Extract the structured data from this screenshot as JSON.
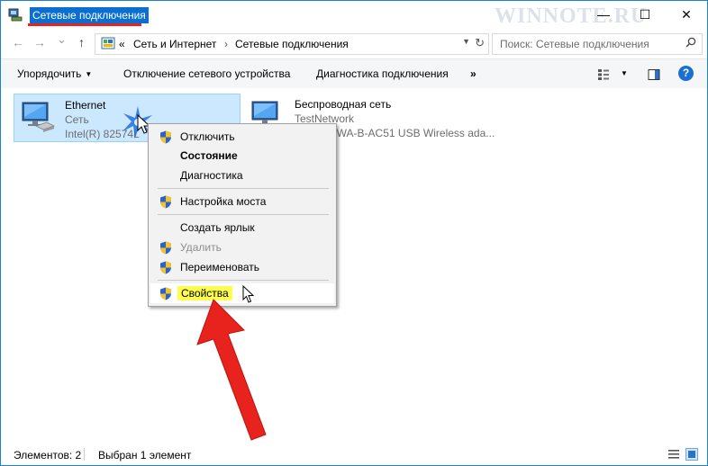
{
  "window": {
    "title": "Сетевые подключения",
    "watermark": "WINNOTE.RU",
    "controls": {
      "minimize": "—",
      "maximize": "☐",
      "close": "✕"
    }
  },
  "address": {
    "back": "←",
    "forward": "→",
    "dropdown": "⌄",
    "up": "↑",
    "chevrons": "«",
    "crumbs": [
      "Сеть и Интернет",
      "Сетевые подключения"
    ],
    "separator": "›",
    "dd_arrow": "▼",
    "refresh": "↻"
  },
  "search": {
    "placeholder": "Поиск: Сетевые подключения"
  },
  "toolbar": {
    "organize": "Упорядочить",
    "organize_arrow": "▼",
    "disable_device": "Отключение сетевого устройства",
    "diagnose": "Диагностика подключения",
    "more": "»",
    "view_arrow": "▼",
    "help": "?"
  },
  "connections": [
    {
      "name": "Ethernet",
      "network": "Сеть",
      "device": "Intel(R) 82574L",
      "selected": true
    },
    {
      "name": "Беспроводная сеть",
      "network": "TestNetwork",
      "device": "D-Link DWA-B-AC51 USB Wireless ada..."
    }
  ],
  "context_menu": {
    "items": [
      {
        "label": "Отключить",
        "shield": true
      },
      {
        "label": "Состояние",
        "bold": true
      },
      {
        "label": "Диагностика"
      },
      {
        "label": "Настройка моста",
        "shield": true
      },
      {
        "label": "Создать ярлык"
      },
      {
        "label": "Удалить",
        "shield": true,
        "disabled": true
      },
      {
        "label": "Переименовать",
        "shield": true
      },
      {
        "label": "Свойства",
        "shield": true,
        "highlighted": true
      }
    ]
  },
  "status": {
    "count": "Элементов: 2",
    "selected": "Выбран 1 элемент"
  },
  "colors": {
    "accent": "#0a6fd1",
    "selection": "#cce8ff",
    "highlight": "#fffe4e",
    "annotation_arrow": "#e8231d"
  }
}
